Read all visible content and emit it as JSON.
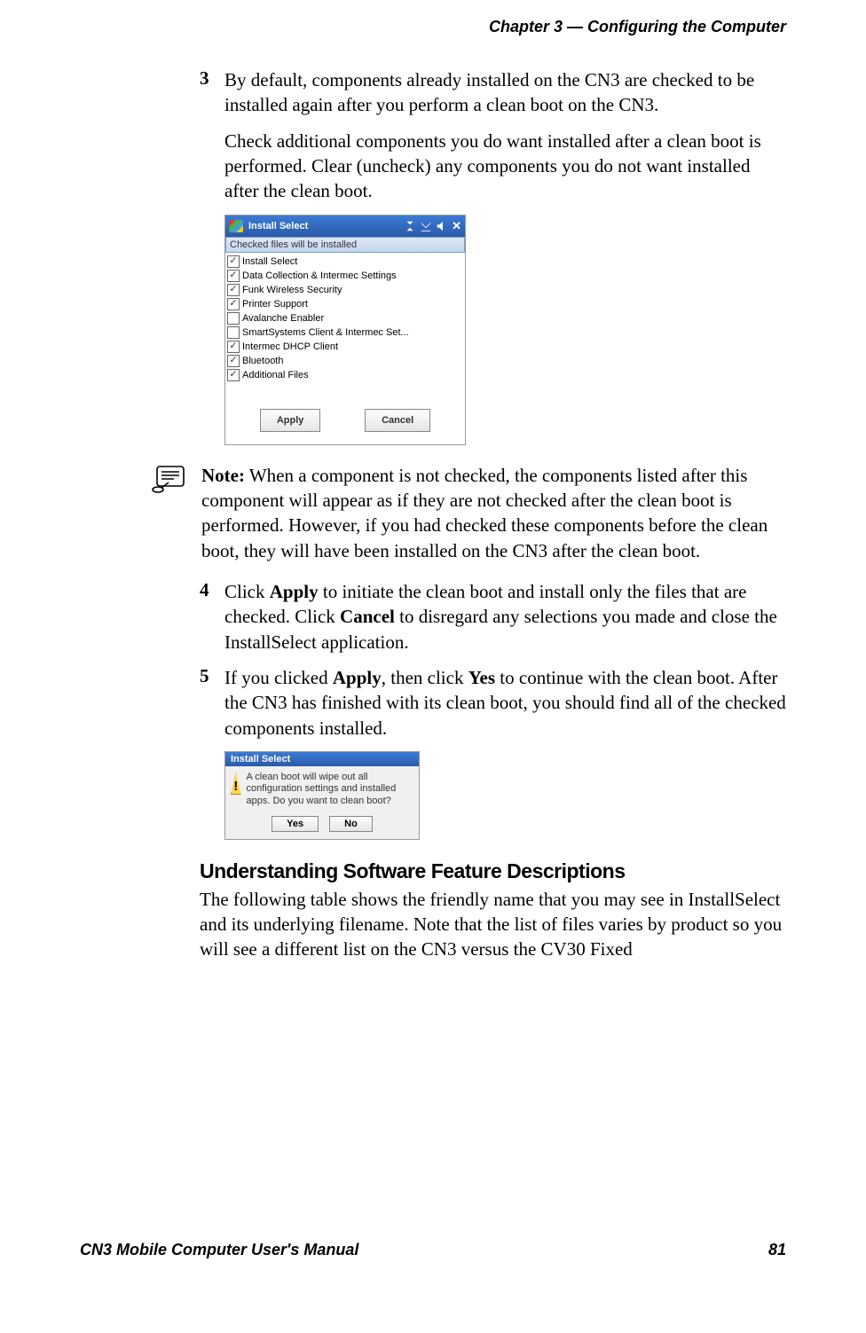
{
  "header": "Chapter 3 —  Configuring the Computer",
  "step3": {
    "num": "3",
    "para1": "By default, components already installed on the CN3 are checked to be installed again after you perform a clean boot on the CN3.",
    "para2": "Check additional components you do want installed after a clean boot is performed. Clear (uncheck) any components you do not want installed after the clean boot."
  },
  "install_select": {
    "title": "Install Select",
    "banner": "Checked files will be installed",
    "items": [
      {
        "checked": true,
        "label": "Install Select"
      },
      {
        "checked": true,
        "label": "Data Collection & Intermec Settings"
      },
      {
        "checked": true,
        "label": "Funk Wireless Security"
      },
      {
        "checked": true,
        "label": "Printer Support"
      },
      {
        "checked": false,
        "label": "Avalanche Enabler"
      },
      {
        "checked": false,
        "label": "SmartSystems Client & Intermec Set..."
      },
      {
        "checked": true,
        "label": "Intermec DHCP Client"
      },
      {
        "checked": true,
        "label": "Bluetooth"
      },
      {
        "checked": true,
        "label": "Additional Files"
      }
    ],
    "apply": "Apply",
    "cancel": "Cancel"
  },
  "note": {
    "label": "Note:",
    "text": " When a component is not checked, the components listed after this component will appear as if they are not checked after the clean boot is performed. However, if you had checked these components before the clean boot, they will have been installed on the CN3 after the clean boot."
  },
  "step4": {
    "num": "4",
    "pre": "Click ",
    "bold1": "Apply",
    "mid": " to initiate the clean boot and install only the files that are checked. Click ",
    "bold2": "Cancel",
    "post": " to disregard any selections you made and close the InstallSelect application."
  },
  "step5": {
    "num": "5",
    "pre": "If you clicked ",
    "bold1": "Apply",
    "mid": ", then click ",
    "bold2": "Yes",
    "post": " to continue with the clean boot. After the CN3 has finished with its clean boot, you should find all of the checked components installed."
  },
  "dialog": {
    "title": "Install Select",
    "text": "A clean boot will wipe out all configuration settings and installed apps. Do you want to clean boot?",
    "yes": "Yes",
    "no": "No"
  },
  "subhead": "Understanding Software Feature Descriptions",
  "subpara": "The following table shows the friendly name that you may see in InstallSelect and its underlying filename. Note that the list of files varies by product so you will see a different list on the CN3 versus the CV30 Fixed",
  "footer": {
    "left": "CN3 Mobile Computer User's Manual",
    "right": "81"
  }
}
